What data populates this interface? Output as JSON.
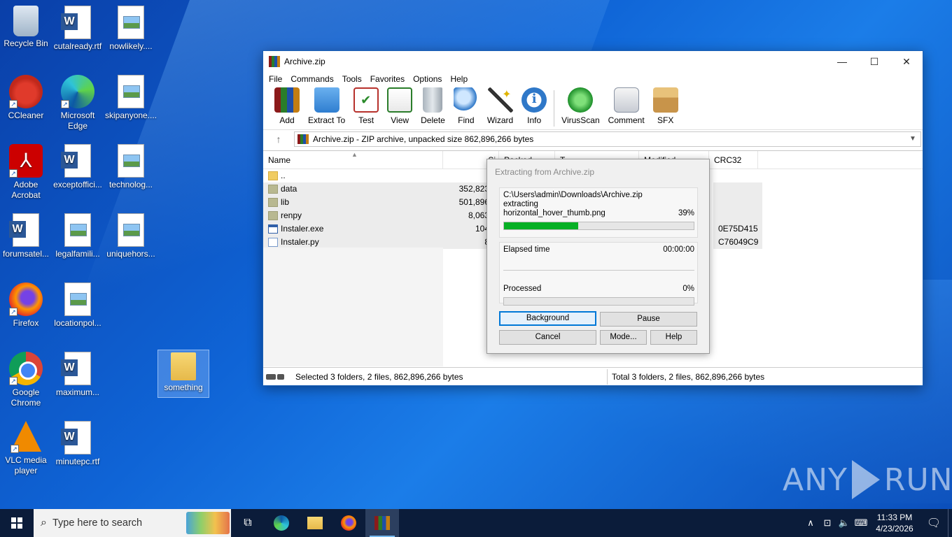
{
  "desktop": {
    "icons": [
      {
        "label": "Recycle Bin",
        "icon": "recycle-bin-icon"
      },
      {
        "label": "cutalready.rtf",
        "icon": "word-doc-icon"
      },
      {
        "label": "nowlikely....",
        "icon": "image-file-icon"
      },
      {
        "label": "CCleaner",
        "icon": "ccleaner-icon"
      },
      {
        "label": "Microsoft Edge",
        "icon": "edge-icon"
      },
      {
        "label": "skipanyone....",
        "icon": "image-file-icon"
      },
      {
        "label": "Adobe Acrobat",
        "icon": "acrobat-icon"
      },
      {
        "label": "exceptoffici...",
        "icon": "word-doc-icon"
      },
      {
        "label": "technolog...",
        "icon": "image-file-icon"
      },
      {
        "label": "forumsatel...",
        "icon": "word-doc-icon"
      },
      {
        "label": "legalfamili...",
        "icon": "image-file-icon"
      },
      {
        "label": "uniquehors...",
        "icon": "image-file-icon"
      },
      {
        "label": "Firefox",
        "icon": "firefox-icon"
      },
      {
        "label": "locationpol...",
        "icon": "image-file-icon"
      },
      {
        "label": "Google Chrome",
        "icon": "chrome-icon"
      },
      {
        "label": "maximum...",
        "icon": "word-doc-icon"
      },
      {
        "label": "something",
        "icon": "folder-icon"
      },
      {
        "label": "VLC media player",
        "icon": "vlc-icon"
      },
      {
        "label": "minutepc.rtf",
        "icon": "word-doc-icon"
      }
    ]
  },
  "window": {
    "title": "Archive.zip",
    "menu": [
      "File",
      "Commands",
      "Tools",
      "Favorites",
      "Options",
      "Help"
    ],
    "toolbar": [
      {
        "label": "Add",
        "icon": "add-archive-icon"
      },
      {
        "label": "Extract To",
        "icon": "extract-folder-icon"
      },
      {
        "label": "Test",
        "icon": "test-clipboard-icon"
      },
      {
        "label": "View",
        "icon": "view-book-icon"
      },
      {
        "label": "Delete",
        "icon": "trash-icon"
      },
      {
        "label": "Find",
        "icon": "magnifier-icon"
      },
      {
        "label": "Wizard",
        "icon": "wand-icon"
      },
      {
        "label": "Info",
        "icon": "info-icon"
      },
      {
        "label": "VirusScan",
        "icon": "virus-scan-icon"
      },
      {
        "label": "Comment",
        "icon": "comment-icon"
      },
      {
        "label": "SFX",
        "icon": "sfx-box-icon"
      }
    ],
    "address": "Archive.zip - ZIP archive, unpacked size 862,896,266 bytes",
    "columns": {
      "name": "Name",
      "size": "Si",
      "packed": "Packed",
      "type": "T",
      "modified": "Modified",
      "crc": "CRC32"
    },
    "files": [
      {
        "name": "..",
        "size": "",
        "crc": "",
        "kind": "updir"
      },
      {
        "name": "data",
        "size": "352,823,3",
        "crc": "",
        "kind": "folder"
      },
      {
        "name": "lib",
        "size": "501,896,4",
        "crc": "",
        "kind": "folder"
      },
      {
        "name": "renpy",
        "size": "8,063,0",
        "crc": "",
        "kind": "folder"
      },
      {
        "name": "Instaler.exe",
        "size": "104,4",
        "crc": "0E75D415",
        "kind": "exe"
      },
      {
        "name": "Instaler.py",
        "size": "8,9",
        "crc": "C76049C9",
        "kind": "py"
      }
    ],
    "status_left": "Selected 3 folders, 2 files, 862,896,266 bytes",
    "status_right": "Total 3 folders, 2 files, 862,896,266 bytes"
  },
  "dialog": {
    "title": "Extracting from Archive.zip",
    "path": "C:\\Users\\admin\\Downloads\\Archive.zip",
    "action": "extracting",
    "current_file": "horizontal_hover_thumb.png",
    "file_percent": "39%",
    "file_progress": 0.39,
    "elapsed_label": "Elapsed time",
    "elapsed_value": "00:00:00",
    "processed_label": "Processed",
    "processed_percent": "0%",
    "processed_progress": 0.0,
    "buttons": {
      "background": "Background",
      "pause": "Pause",
      "cancel": "Cancel",
      "mode": "Mode...",
      "help": "Help"
    }
  },
  "taskbar": {
    "search_placeholder": "Type here to search",
    "time": "11:33 PM",
    "date": "4/23/2026"
  },
  "watermark": {
    "left": "ANY",
    "right": "RUN"
  }
}
